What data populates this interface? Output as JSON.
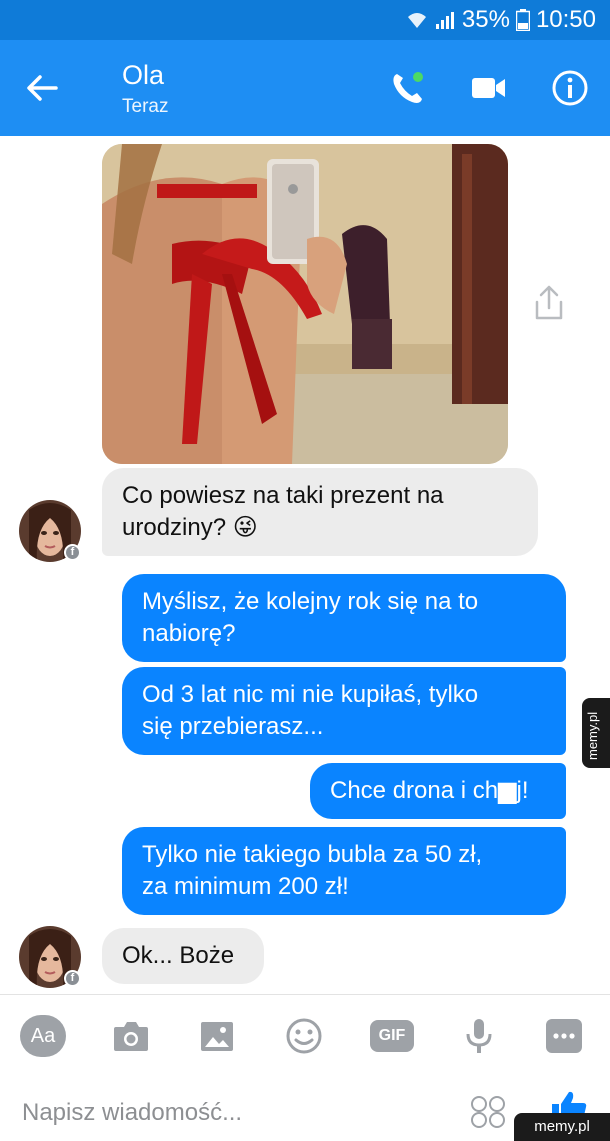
{
  "status_bar": {
    "battery": "35%",
    "time": "10:50",
    "icons": [
      "wifi-icon",
      "signal-icon",
      "battery-icon"
    ]
  },
  "header": {
    "name": "Ola",
    "status": "Teraz",
    "actions": [
      "back-arrow-icon",
      "phone-icon",
      "video-camera-icon",
      "info-icon"
    ],
    "active_dot_color": "#4cd964"
  },
  "chat": {
    "messages": [
      {
        "from": "them",
        "lines": [
          "Co powiesz na taki prezent na",
          "urodziny? 😜"
        ]
      },
      {
        "from": "me",
        "lines": [
          "Myślisz, że kolejny rok się na to",
          "nabiorę?"
        ]
      },
      {
        "from": "me",
        "lines": [
          "Od 3 lat nic mi nie kupiłaś, tylko",
          "się przebierasz..."
        ]
      },
      {
        "from": "me",
        "lines": [
          "Chce drona i ch▆j!"
        ]
      },
      {
        "from": "me",
        "lines": [
          "Tylko nie takiego bubla za 50 zł,",
          "za minimum 200 zł!"
        ]
      },
      {
        "from": "them",
        "lines": [
          "Ok... Boże"
        ]
      }
    ],
    "watermark": "memy.pl"
  },
  "composer": {
    "aa_label": "Aa",
    "gif_label": "GIF",
    "placeholder": "Napisz wiadomość...",
    "watermark": "memy.pl"
  },
  "colors": {
    "header_blue": "#1e8ef3",
    "status_blue": "#0f7bd8",
    "outgoing_bubble": "#0a84ff",
    "incoming_bubble": "#ececec"
  }
}
